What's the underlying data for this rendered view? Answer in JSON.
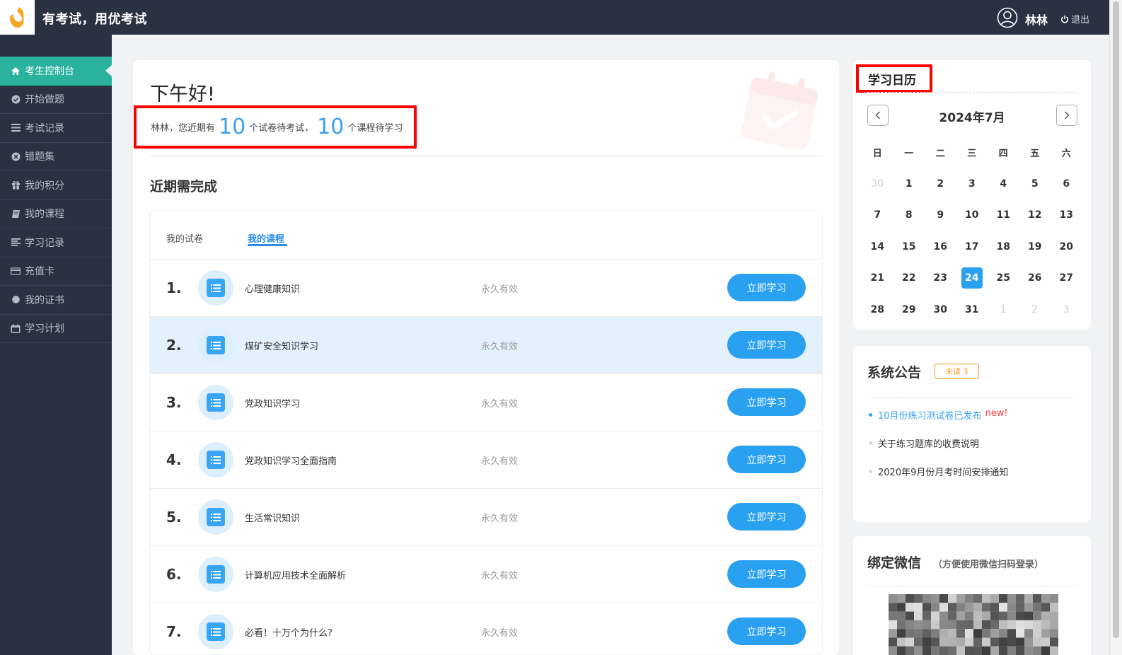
{
  "header": {
    "app_title": "有考试，用优考试",
    "user_name": "林林",
    "logout_label": "退出"
  },
  "sidebar": {
    "items": [
      {
        "label": "考生控制台",
        "icon": "home-icon",
        "active": true
      },
      {
        "label": "开始做题",
        "icon": "check-circle-icon",
        "active": false
      },
      {
        "label": "考试记录",
        "icon": "list-icon",
        "active": false
      },
      {
        "label": "错题集",
        "icon": "x-circle-icon",
        "active": false
      },
      {
        "label": "我的积分",
        "icon": "gift-icon",
        "active": false
      },
      {
        "label": "我的课程",
        "icon": "book-icon",
        "active": false
      },
      {
        "label": "学习记录",
        "icon": "align-left-icon",
        "active": false
      },
      {
        "label": "充值卡",
        "icon": "credit-card-icon",
        "active": false
      },
      {
        "label": "我的证书",
        "icon": "badge-icon",
        "active": false
      },
      {
        "label": "学习计划",
        "icon": "calendar-icon",
        "active": false
      }
    ]
  },
  "main": {
    "greeting": "下午好!",
    "summary": {
      "prefix": "林林，您近期有",
      "exam_count": "10",
      "exam_text": "个试卷待考试，",
      "course_count": "10",
      "course_text": "个课程待学习"
    },
    "section_title": "近期需完成",
    "tabs": [
      {
        "label": "我的试卷",
        "active": false
      },
      {
        "label": "我的课程",
        "active": true
      }
    ],
    "courses": [
      {
        "num": "1.",
        "name": "心理健康知识",
        "validity": "永久有效",
        "action": "立即学习"
      },
      {
        "num": "2.",
        "name": "煤矿安全知识学习",
        "validity": "永久有效",
        "action": "立即学习"
      },
      {
        "num": "3.",
        "name": "党政知识学习",
        "validity": "永久有效",
        "action": "立即学习"
      },
      {
        "num": "4.",
        "name": "党政知识学习全面指南",
        "validity": "永久有效",
        "action": "立即学习"
      },
      {
        "num": "5.",
        "name": "生活常识知识",
        "validity": "永久有效",
        "action": "立即学习"
      },
      {
        "num": "6.",
        "name": "计算机应用技术全面解析",
        "validity": "永久有效",
        "action": "立即学习"
      },
      {
        "num": "7.",
        "name": "必看！十万个为什么?",
        "validity": "永久有效",
        "action": "立即学习"
      }
    ]
  },
  "calendar": {
    "title": "学习日历",
    "month_label": "2024年7月",
    "weekdays": [
      "日",
      "一",
      "二",
      "三",
      "四",
      "五",
      "六"
    ],
    "days": [
      "30",
      "1",
      "2",
      "3",
      "4",
      "5",
      "6",
      "7",
      "8",
      "9",
      "10",
      "11",
      "12",
      "13",
      "14",
      "15",
      "16",
      "17",
      "18",
      "19",
      "20",
      "21",
      "22",
      "23",
      "24",
      "25",
      "26",
      "27",
      "28",
      "29",
      "30",
      "31",
      "1",
      "2",
      "3"
    ],
    "today": "24"
  },
  "notice": {
    "title": "系统公告",
    "badge": "未读 3",
    "items": [
      {
        "text": "10月份练习测试卷已发布",
        "tag": "new!"
      },
      {
        "text": "关于练习题库的收费说明",
        "tag": ""
      },
      {
        "text": "2020年9月份月考时间安排通知",
        "tag": ""
      }
    ]
  },
  "wechat": {
    "title": "绑定微信",
    "subtitle": "（方便使用微信扫码登录）"
  },
  "colors": {
    "topbar": "#2a3241",
    "sidebar_active": "#2ab29f",
    "accent_blue": "#2aa1f0",
    "highlight_box": "#ff0000",
    "badge_orange": "#f39a2b"
  }
}
